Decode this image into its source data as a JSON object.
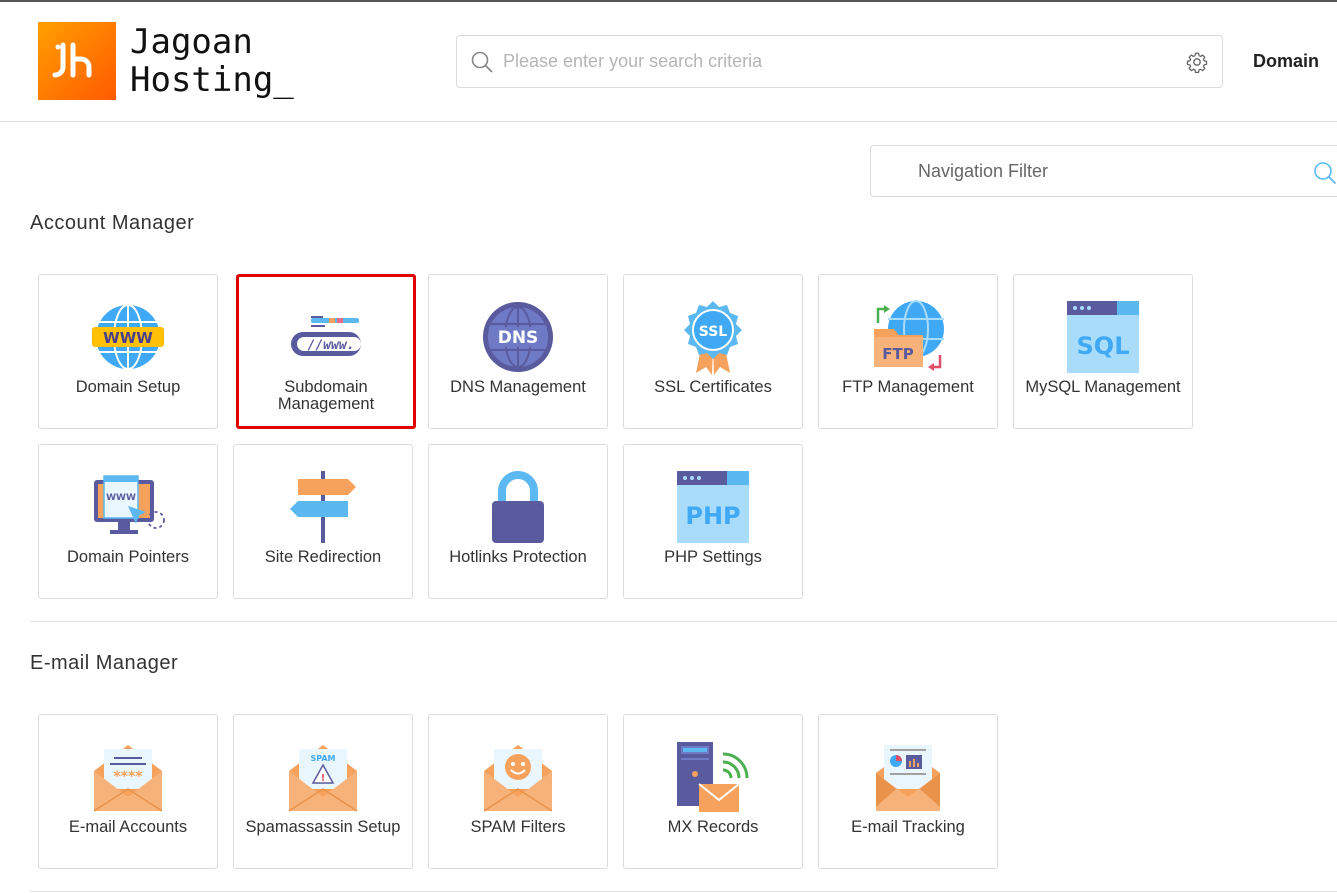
{
  "brand": {
    "line1": "Jagoan",
    "line2": "Hosting_"
  },
  "header": {
    "search_placeholder": "Please enter your search criteria",
    "domain_label": "Domain"
  },
  "nav_filter": {
    "placeholder": "Navigation Filter"
  },
  "sections": {
    "account": {
      "title": "Account Manager",
      "tiles": [
        {
          "label": "Domain Setup",
          "icon": "www-globe-icon"
        },
        {
          "label": "Subdomain Management",
          "icon": "www-address-bar-icon",
          "selected": true
        },
        {
          "label": "DNS Management",
          "icon": "dns-globe-icon"
        },
        {
          "label": "SSL Certificates",
          "icon": "ssl-badge-icon"
        },
        {
          "label": "FTP Management",
          "icon": "ftp-folder-icon"
        },
        {
          "label": "MySQL Management",
          "icon": "sql-window-icon"
        },
        {
          "label": "Domain Pointers",
          "icon": "domain-pointer-monitor-icon"
        },
        {
          "label": "Site Redirection",
          "icon": "signpost-icon"
        },
        {
          "label": "Hotlinks Protection",
          "icon": "padlock-icon"
        },
        {
          "label": "PHP Settings",
          "icon": "php-window-icon"
        }
      ]
    },
    "email": {
      "title": "E-mail Manager",
      "tiles": [
        {
          "label": "E-mail Accounts",
          "icon": "envelope-password-icon"
        },
        {
          "label": "Spamassassin Setup",
          "icon": "envelope-spam-warning-icon"
        },
        {
          "label": "SPAM Filters",
          "icon": "envelope-smiley-icon"
        },
        {
          "label": "MX Records",
          "icon": "server-mail-icon"
        },
        {
          "label": "E-mail Tracking",
          "icon": "envelope-chart-icon"
        }
      ]
    }
  },
  "colors": {
    "brand_orange": "#ff7a00",
    "selected_border": "#e00000",
    "icon_blue": "#5bb8f0",
    "icon_purple": "#5a5a9e",
    "icon_orange": "#f6a25c"
  }
}
